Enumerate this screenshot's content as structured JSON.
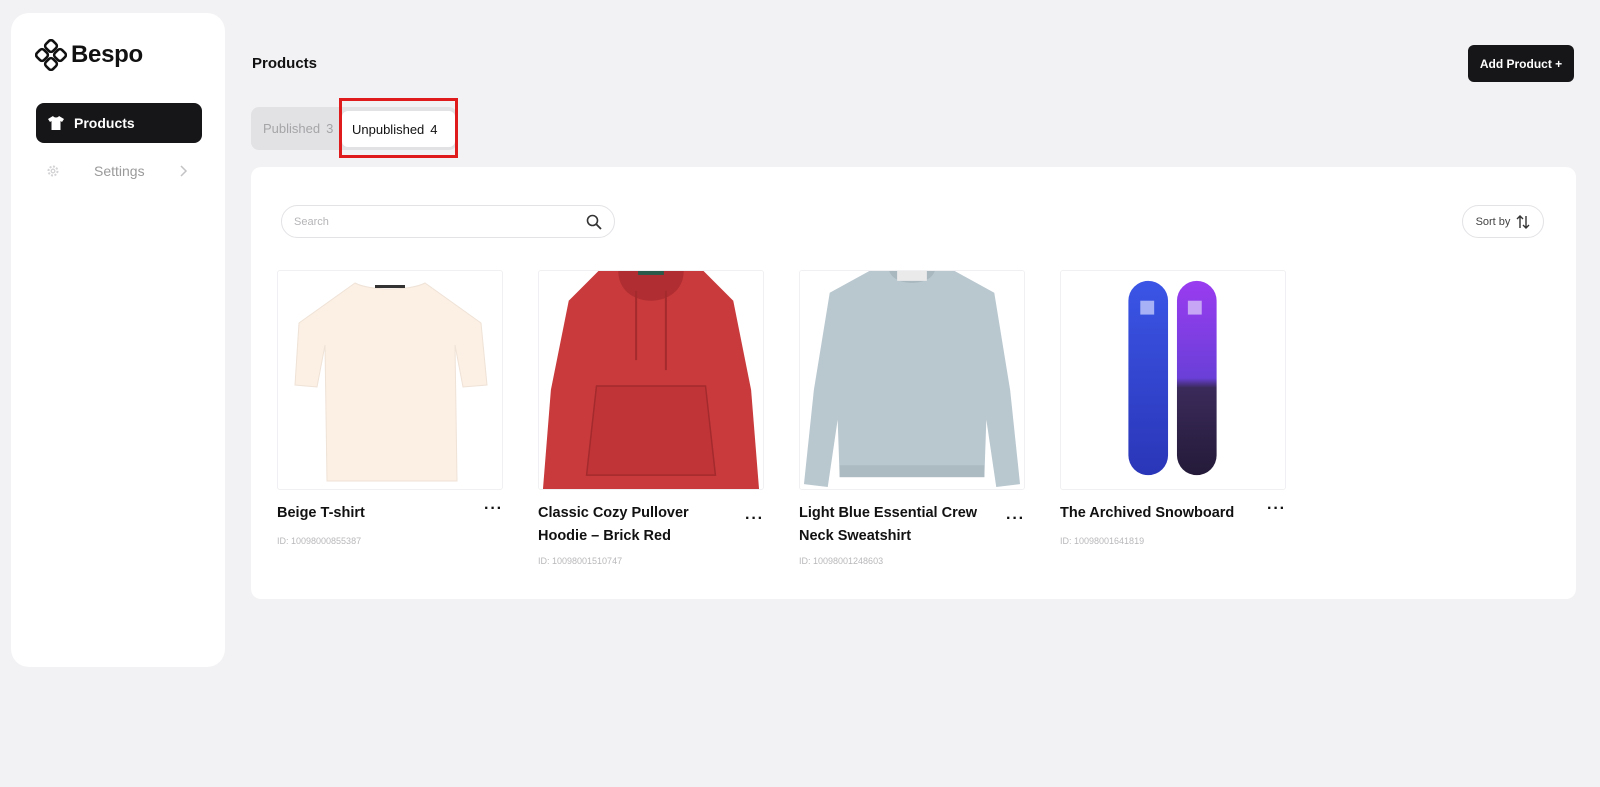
{
  "brand": {
    "name": "Bespo"
  },
  "sidebar": {
    "items": [
      {
        "label": "Products",
        "icon": "tshirt-icon",
        "active": true
      },
      {
        "label": "Settings",
        "icon": "gear-icon",
        "active": false
      }
    ]
  },
  "header": {
    "title": "Products",
    "add_button": "Add Product +"
  },
  "tabs": [
    {
      "label": "Published",
      "count": "3"
    },
    {
      "label": "Unpublished",
      "count": "4",
      "active": true
    }
  ],
  "toolbar": {
    "search_placeholder": "Search",
    "sort_label": "Sort by"
  },
  "products": [
    {
      "title": "Beige T-shirt",
      "id": "ID: 10098000855387",
      "image": "beige-tshirt"
    },
    {
      "title": "Classic Cozy Pullover Hoodie – Brick Red",
      "id": "ID: 10098001510747",
      "image": "red-hoodie"
    },
    {
      "title": "Light Blue Essential Crew Neck Sweatshirt",
      "id": "ID: 10098001248603",
      "image": "blue-sweatshirt"
    },
    {
      "title": "The Archived Snowboard",
      "id": "ID: 10098001641819",
      "image": "snowboards"
    }
  ],
  "colors": {
    "accent": "#161618",
    "highlight": "#e01b1b"
  }
}
